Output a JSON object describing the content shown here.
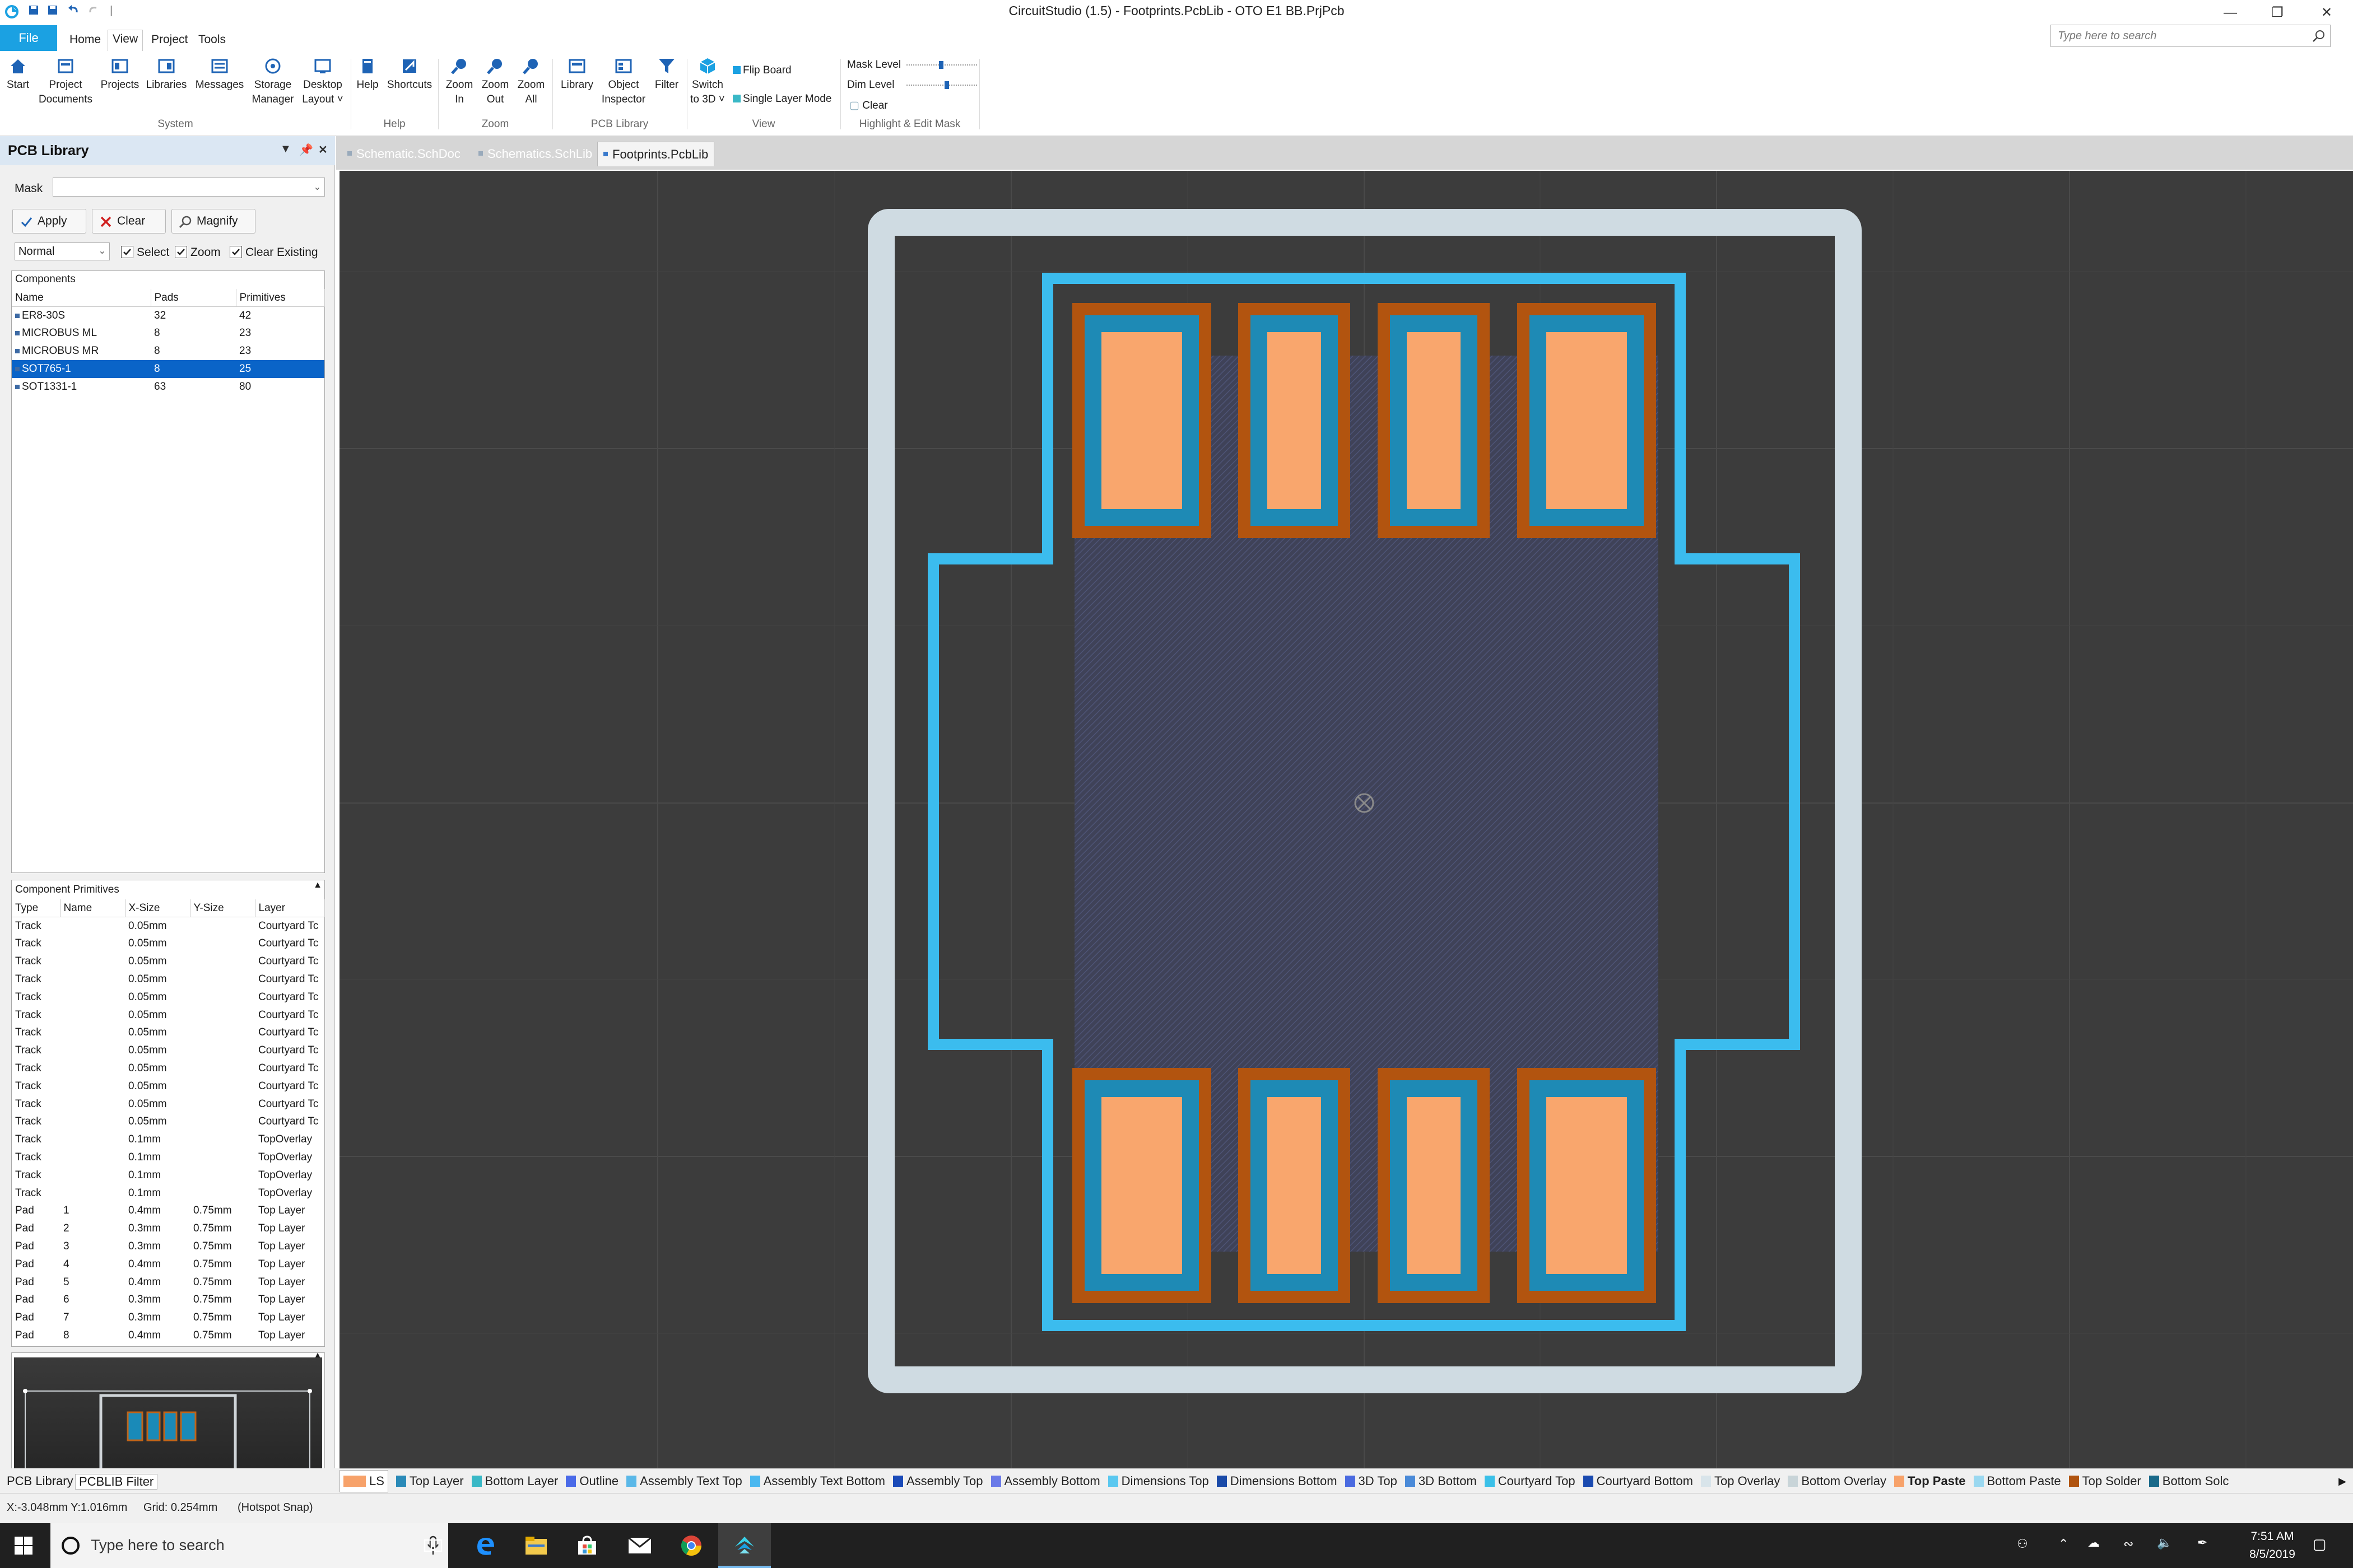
{
  "titlebar": {
    "title": "CircuitStudio (1.5) - Footprints.PcbLib - OTO E1 BB.PrjPcb"
  },
  "menu": {
    "file": "File",
    "items": [
      "Home",
      "View",
      "Project",
      "Tools"
    ],
    "search_placeholder": "Type here to search"
  },
  "ribbon": {
    "buttons": [
      {
        "label1": "Start",
        "label2": ""
      },
      {
        "label1": "Project",
        "label2": "Documents"
      },
      {
        "label1": "Projects",
        "label2": ""
      },
      {
        "label1": "Libraries",
        "label2": ""
      },
      {
        "label1": "Messages",
        "label2": ""
      },
      {
        "label1": "Storage",
        "label2": "Manager"
      },
      {
        "label1": "Desktop",
        "label2": "Layout ˅"
      },
      {
        "label1": "Help",
        "label2": ""
      },
      {
        "label1": "Shortcuts",
        "label2": ""
      },
      {
        "label1": "Zoom",
        "label2": "In"
      },
      {
        "label1": "Zoom",
        "label2": "Out"
      },
      {
        "label1": "Zoom",
        "label2": "All"
      },
      {
        "label1": "Library",
        "label2": ""
      },
      {
        "label1": "Object",
        "label2": "Inspector"
      },
      {
        "label1": "Filter",
        "label2": ""
      },
      {
        "label1": "Switch",
        "label2": "to 3D ˅"
      }
    ],
    "flip_board": "Flip Board",
    "single_layer_mode": "Single Layer Mode",
    "mask_level": "Mask Level",
    "dim_level": "Dim Level",
    "clear": "Clear",
    "groups": [
      "System",
      "Help",
      "Zoom",
      "PCB Library",
      "View",
      "Highlight & Edit Mask"
    ]
  },
  "panel": {
    "title": "PCB Library",
    "mask_label": "Mask",
    "apply": "Apply",
    "clear": "Clear",
    "magnify": "Magnify",
    "mode": "Normal",
    "select": "Select",
    "zoom": "Zoom",
    "clear_existing": "Clear Existing",
    "components_header": "Components",
    "components_cols": [
      "Name",
      "Pads",
      "Primitives"
    ],
    "components": [
      {
        "name": "ER8-30S",
        "pads": "32",
        "prims": "42"
      },
      {
        "name": "MICROBUS ML",
        "pads": "8",
        "prims": "23"
      },
      {
        "name": "MICROBUS MR",
        "pads": "8",
        "prims": "23"
      },
      {
        "name": "SOT765-1",
        "pads": "8",
        "prims": "25"
      },
      {
        "name": "SOT1331-1",
        "pads": "63",
        "prims": "80"
      }
    ],
    "selected_component": 3,
    "primitives_header": "Component Primitives",
    "primitives_cols": [
      "Type",
      "Name",
      "X-Size",
      "Y-Size",
      "Layer"
    ],
    "primitives": [
      [
        "Track",
        "",
        "0.05mm",
        "",
        "Courtyard Tc"
      ],
      [
        "Track",
        "",
        "0.05mm",
        "",
        "Courtyard Tc"
      ],
      [
        "Track",
        "",
        "0.05mm",
        "",
        "Courtyard Tc"
      ],
      [
        "Track",
        "",
        "0.05mm",
        "",
        "Courtyard Tc"
      ],
      [
        "Track",
        "",
        "0.05mm",
        "",
        "Courtyard Tc"
      ],
      [
        "Track",
        "",
        "0.05mm",
        "",
        "Courtyard Tc"
      ],
      [
        "Track",
        "",
        "0.05mm",
        "",
        "Courtyard Tc"
      ],
      [
        "Track",
        "",
        "0.05mm",
        "",
        "Courtyard Tc"
      ],
      [
        "Track",
        "",
        "0.05mm",
        "",
        "Courtyard Tc"
      ],
      [
        "Track",
        "",
        "0.05mm",
        "",
        "Courtyard Tc"
      ],
      [
        "Track",
        "",
        "0.05mm",
        "",
        "Courtyard Tc"
      ],
      [
        "Track",
        "",
        "0.05mm",
        "",
        "Courtyard Tc"
      ],
      [
        "Track",
        "",
        "0.1mm",
        "",
        "TopOverlay"
      ],
      [
        "Track",
        "",
        "0.1mm",
        "",
        "TopOverlay"
      ],
      [
        "Track",
        "",
        "0.1mm",
        "",
        "TopOverlay"
      ],
      [
        "Track",
        "",
        "0.1mm",
        "",
        "TopOverlay"
      ],
      [
        "Pad",
        "1",
        "0.4mm",
        "0.75mm",
        "Top Layer"
      ],
      [
        "Pad",
        "2",
        "0.3mm",
        "0.75mm",
        "Top Layer"
      ],
      [
        "Pad",
        "3",
        "0.3mm",
        "0.75mm",
        "Top Layer"
      ],
      [
        "Pad",
        "4",
        "0.4mm",
        "0.75mm",
        "Top Layer"
      ],
      [
        "Pad",
        "5",
        "0.4mm",
        "0.75mm",
        "Top Layer"
      ],
      [
        "Pad",
        "6",
        "0.3mm",
        "0.75mm",
        "Top Layer"
      ],
      [
        "Pad",
        "7",
        "0.3mm",
        "0.75mm",
        "Top Layer"
      ],
      [
        "Pad",
        "8",
        "0.4mm",
        "0.75mm",
        "Top Layer"
      ]
    ]
  },
  "doc_tabs": [
    "Schematic.SchDoc",
    "Schematics.SchLib",
    "Footprints.PcbLib"
  ],
  "active_doc_tab": 2,
  "layers": [
    {
      "name": "LS",
      "color": "#f7a26a"
    },
    {
      "name": "Top Layer",
      "color": "#2a8ab8"
    },
    {
      "name": "Bottom Layer",
      "color": "#39b8c6"
    },
    {
      "name": "Outline",
      "color": "#4a6ae8"
    },
    {
      "name": "Assembly Text Top",
      "color": "#5ab8e8"
    },
    {
      "name": "Assembly Text Bottom",
      "color": "#4ab8f0"
    },
    {
      "name": "Assembly Top",
      "color": "#1a4ab8"
    },
    {
      "name": "Assembly Bottom",
      "color": "#6a7ae8"
    },
    {
      "name": "Dimensions Top",
      "color": "#5ac8f0"
    },
    {
      "name": "Dimensions Bottom",
      "color": "#1a4aa8"
    },
    {
      "name": "3D Top",
      "color": "#4a6ae0"
    },
    {
      "name": "3D Bottom",
      "color": "#4a8ad8"
    },
    {
      "name": "Courtyard Top",
      "color": "#3ac0e8"
    },
    {
      "name": "Courtyard Bottom",
      "color": "#1a4ab0"
    },
    {
      "name": "Top Overlay",
      "color": "#d8e4ea"
    },
    {
      "name": "Bottom Overlay",
      "color": "#c8d4d8"
    },
    {
      "name": "Top Paste",
      "color": "#f7a26a"
    },
    {
      "name": "Bottom Paste",
      "color": "#9ad8f0"
    },
    {
      "name": "Top Solder",
      "color": "#b05410"
    },
    {
      "name": "Bottom Solc",
      "color": "#1a6a8a"
    }
  ],
  "active_layer": "Top Paste",
  "bottom_tabs": [
    "PCB Library",
    "PCBLIB Filter"
  ],
  "status": {
    "coords": "X:-3.048mm Y:1.016mm",
    "grid": "Grid: 0.254mm",
    "snap": "(Hotspot Snap)"
  },
  "taskbar": {
    "search_placeholder": "Type here to search",
    "time": "7:51 AM",
    "date": "8/5/2019"
  }
}
